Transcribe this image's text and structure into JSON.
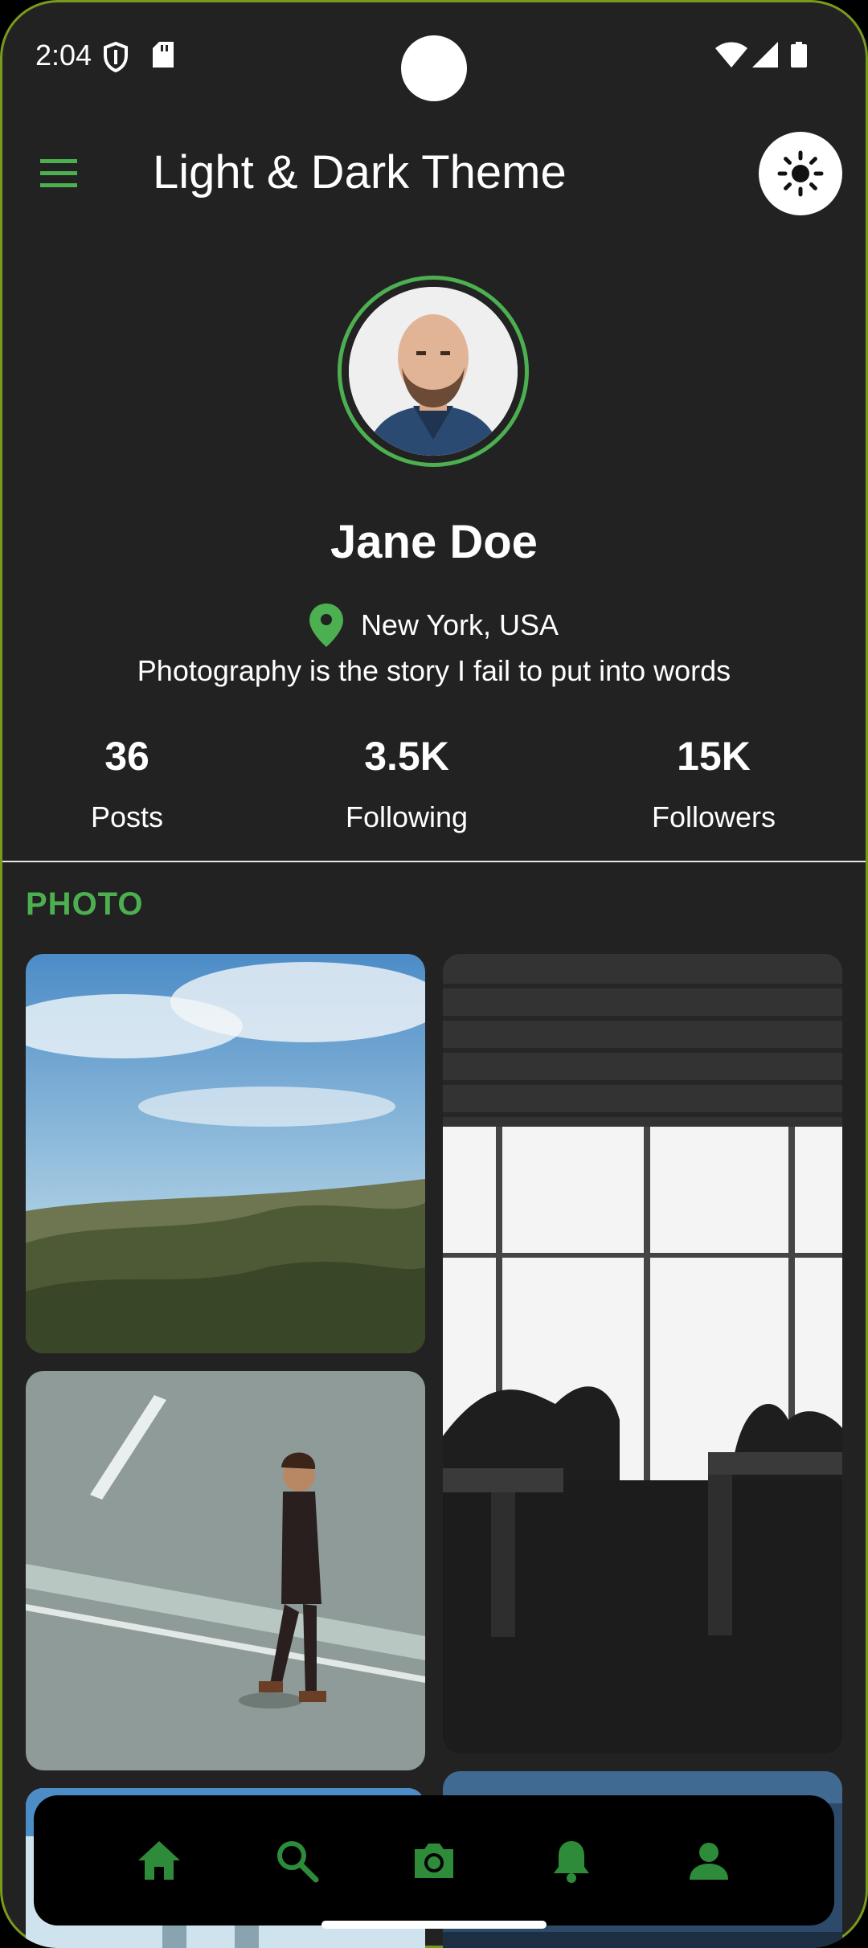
{
  "status_bar": {
    "time": "2:04",
    "icons": [
      "shield-icon",
      "sd-card-icon",
      "wifi-icon",
      "signal-icon",
      "battery-icon"
    ]
  },
  "app_bar": {
    "title": "Light & Dark Theme",
    "menu_icon": "menu-icon",
    "theme_toggle_icon": "sun-icon"
  },
  "profile": {
    "name": "Jane Doe",
    "location": "New York, USA",
    "bio": "Photography is the story I fail to put into words"
  },
  "stats": [
    {
      "value": "36",
      "label": "Posts"
    },
    {
      "value": "3.5K",
      "label": "Following"
    },
    {
      "value": "15K",
      "label": "Followers"
    }
  ],
  "section": {
    "label": "PHOTO"
  },
  "bottom_nav": [
    {
      "icon": "home-icon"
    },
    {
      "icon": "search-icon"
    },
    {
      "icon": "camera-icon"
    },
    {
      "icon": "bell-icon"
    },
    {
      "icon": "person-icon"
    }
  ],
  "colors": {
    "background": "#222222",
    "accent": "#4caf50",
    "text": "#ffffff",
    "nav_background": "#000000"
  }
}
